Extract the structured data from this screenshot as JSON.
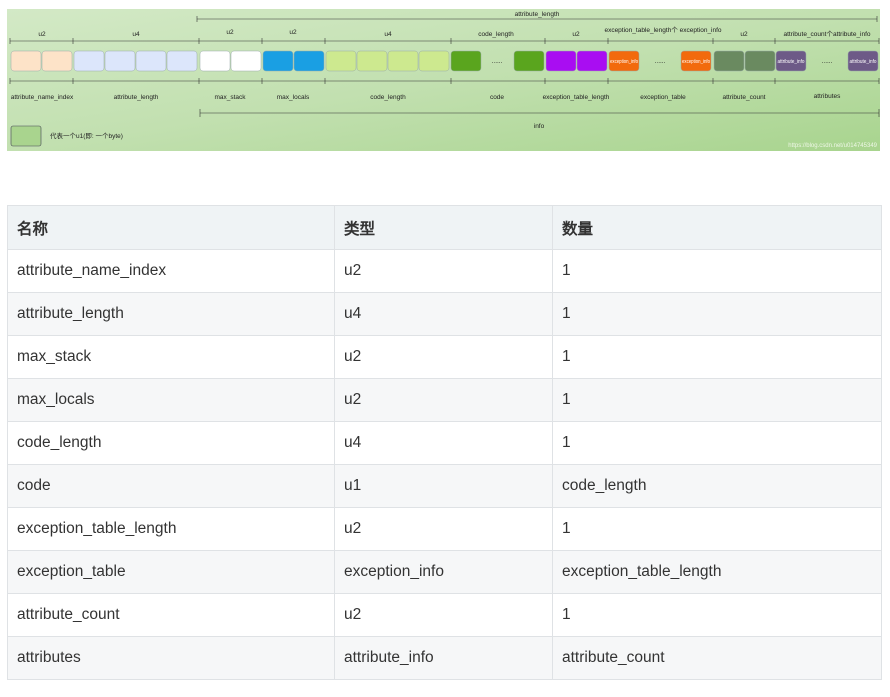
{
  "diagram": {
    "overall_label": "attribute_length",
    "info_label": "info",
    "legend_text": "代表一个u1(即: 一个byte)",
    "watermark": "https://blog.csdn.net/u014745349",
    "type_labels": [
      {
        "text": "u2"
      },
      {
        "text": "u4"
      },
      {
        "text": "u2"
      },
      {
        "text": "u2"
      },
      {
        "text": "u4"
      },
      {
        "text": "code_length"
      },
      {
        "text": "u2"
      },
      {
        "text": "exception_table_length个 exception_info"
      },
      {
        "text": "u2"
      },
      {
        "text": "attribute_count个attribute_info"
      }
    ],
    "field_labels": [
      {
        "text": "attribute_name_index"
      },
      {
        "text": "attribute_length"
      },
      {
        "text": "max_stack"
      },
      {
        "text": "max_locals"
      },
      {
        "text": "code_length"
      },
      {
        "text": "code"
      },
      {
        "text": "exception_table_length"
      },
      {
        "text": "exception_table"
      },
      {
        "text": "attribute_count"
      },
      {
        "text": "attributes"
      }
    ],
    "box_texts": {
      "exception_info": "exception_info",
      "attribute_info": "attribute_info",
      "ellipsis": "......"
    },
    "colors": {
      "attribute_name_index": "#fde3c8",
      "attribute_length": "#dce6fb",
      "max_stack": "#ffffff",
      "max_locals": "#1a9fe3",
      "code_length": "#cde98f",
      "code": "#5aa51e",
      "exception_table_length": "#a90df2",
      "exception_table": "#f26a0d",
      "attribute_count": "#6a8a60",
      "attributes": "#6d5a87"
    }
  },
  "table": {
    "headers": [
      "名称",
      "类型",
      "数量"
    ],
    "rows": [
      {
        "name": "attribute_name_index",
        "type": "u2",
        "count": "1"
      },
      {
        "name": "attribute_length",
        "type": "u4",
        "count": "1"
      },
      {
        "name": "max_stack",
        "type": "u2",
        "count": "1"
      },
      {
        "name": "max_locals",
        "type": "u2",
        "count": "1"
      },
      {
        "name": "code_length",
        "type": "u4",
        "count": "1"
      },
      {
        "name": "code",
        "type": "u1",
        "count": "code_length"
      },
      {
        "name": "exception_table_length",
        "type": "u2",
        "count": "1"
      },
      {
        "name": "exception_table",
        "type": "exception_info",
        "count": "exception_table_length"
      },
      {
        "name": "attribute_count",
        "type": "u2",
        "count": "1"
      },
      {
        "name": "attributes",
        "type": "attribute_info",
        "count": "attribute_count"
      }
    ]
  }
}
